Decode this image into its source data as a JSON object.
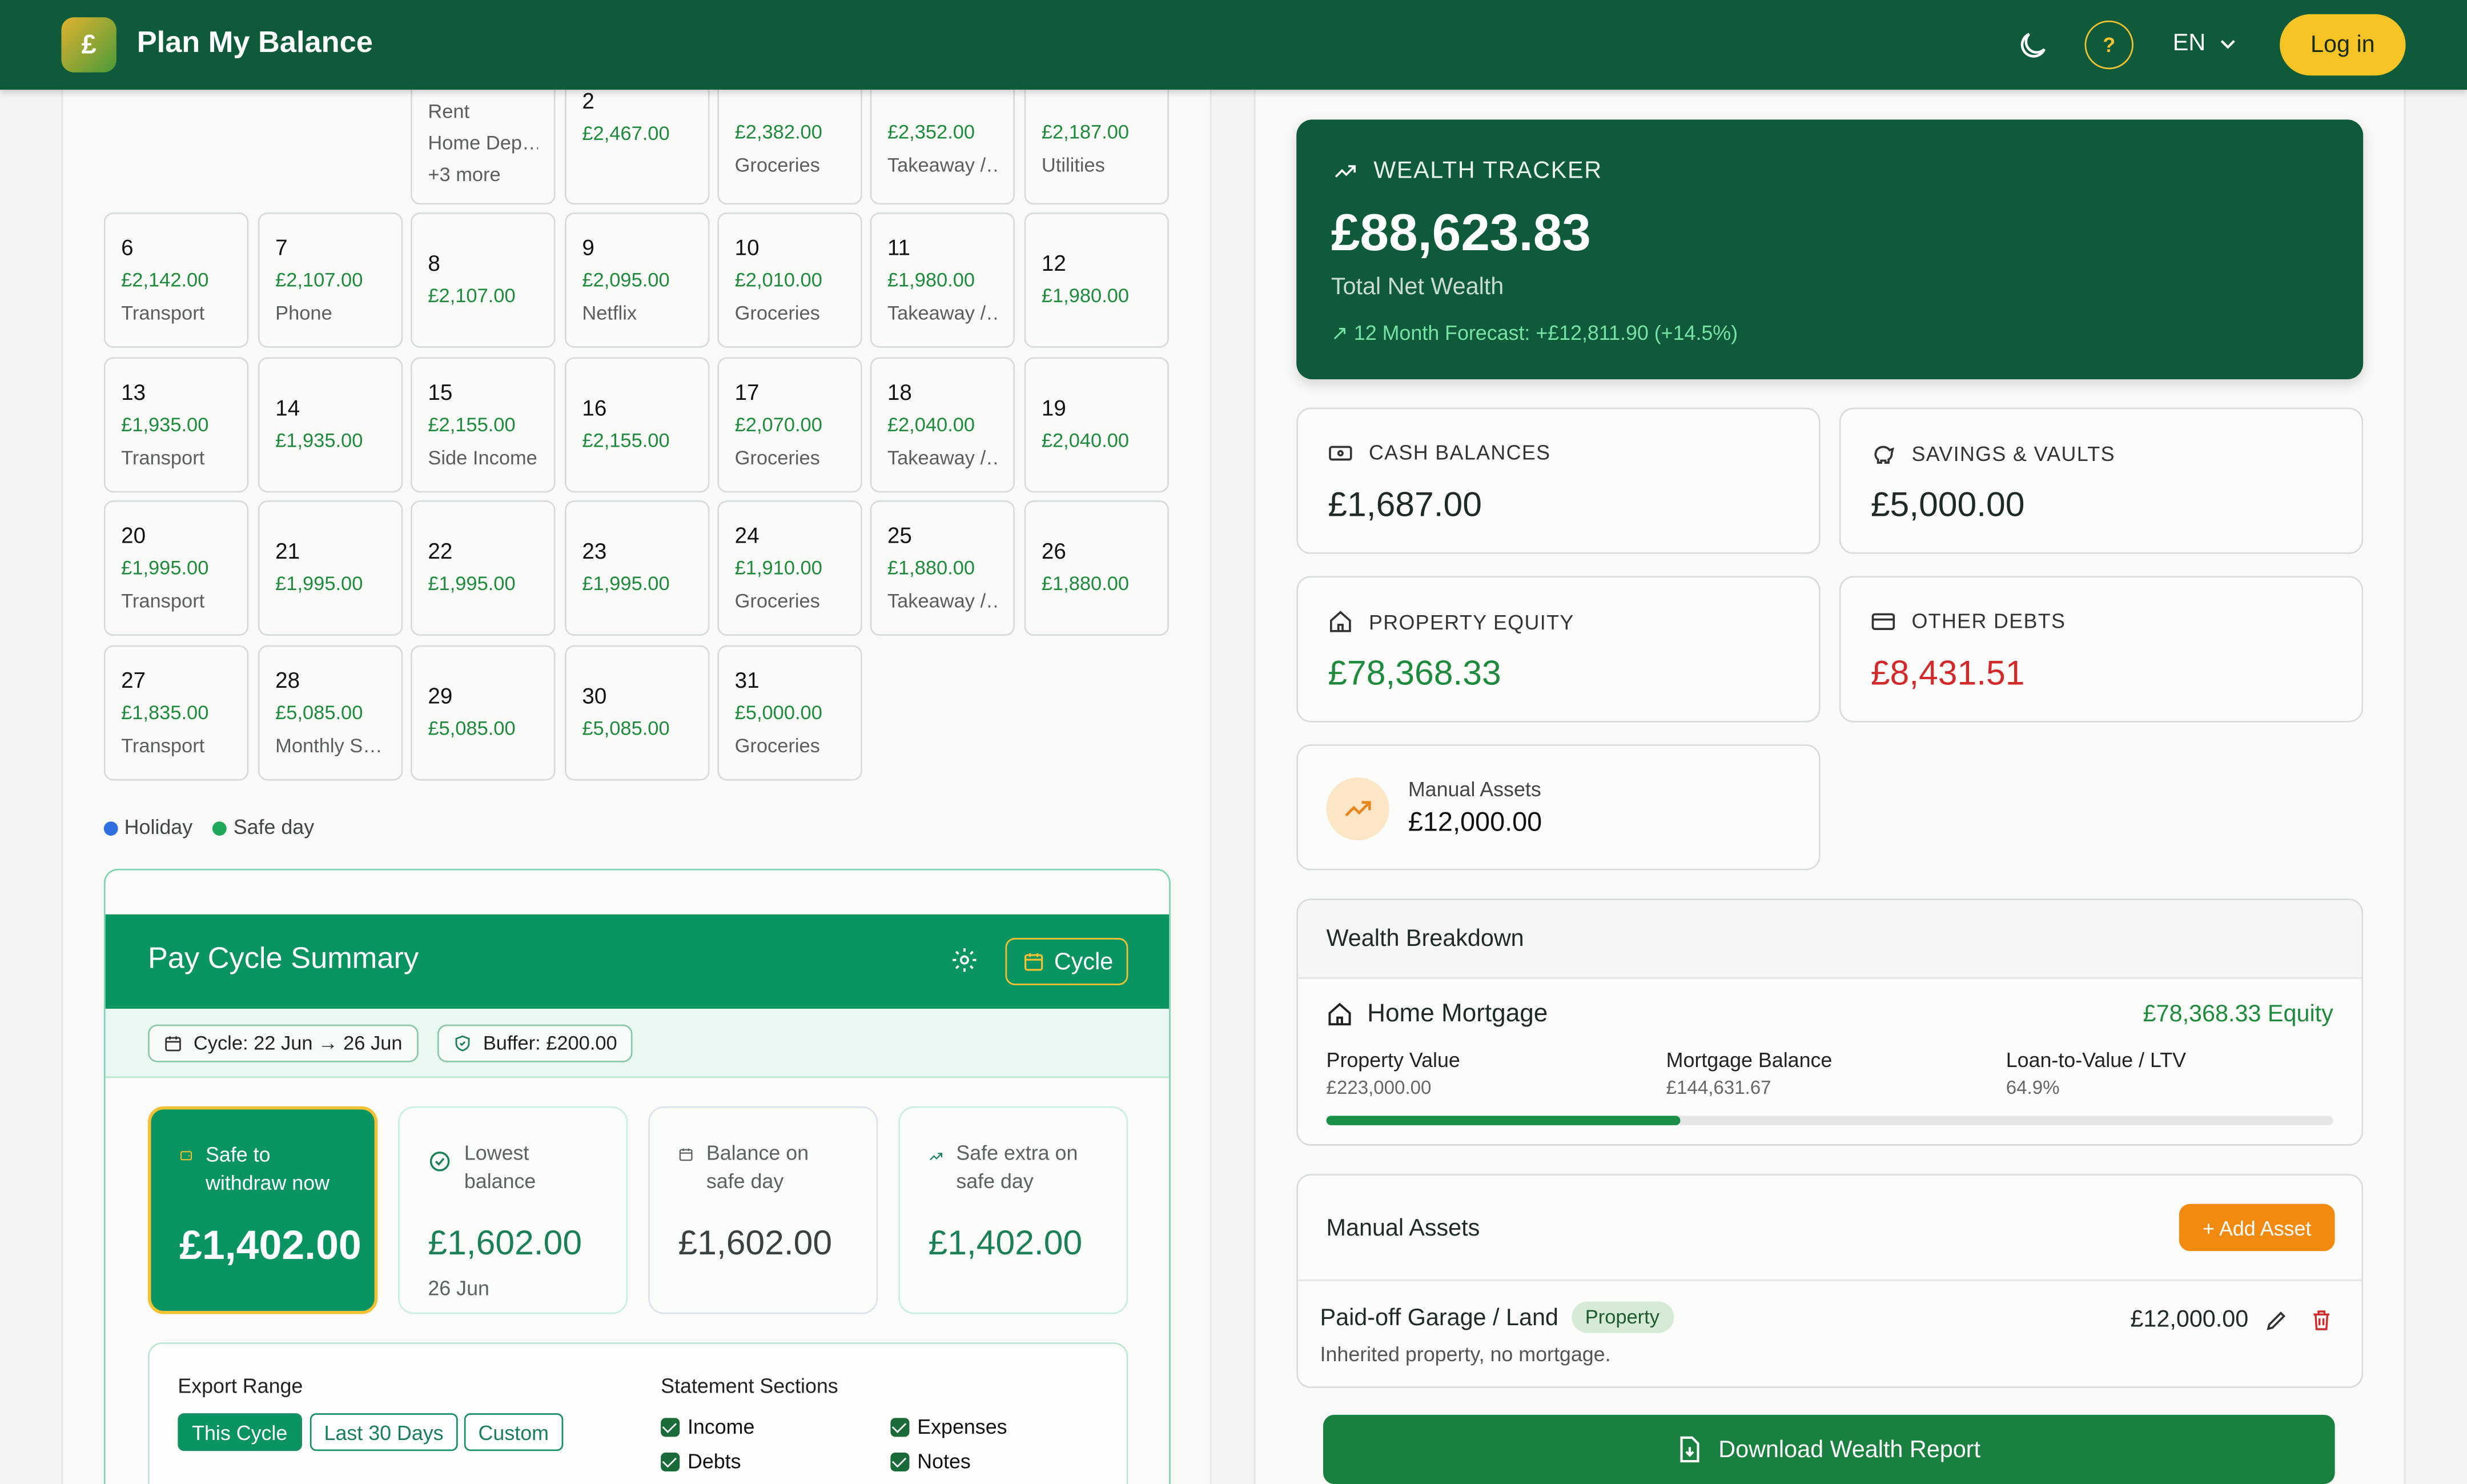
{
  "header": {
    "brand": "Plan My Balance",
    "logo": "£",
    "help": "?",
    "lang": "EN",
    "login": "Log in"
  },
  "calendar": {
    "top_partial": [
      {
        "date": "",
        "amount": "",
        "label": "Rent",
        "label2": "Home Dep…",
        "more": "+3 more"
      },
      {
        "date": "2",
        "amount": "£2,467.00",
        "label": ""
      },
      {
        "date": "",
        "amount": "£2,382.00",
        "label": "Groceries"
      },
      {
        "date": "",
        "amount": "£2,352.00",
        "label": "Takeaway /…"
      },
      {
        "date": "",
        "amount": "£2,187.00",
        "label": "Utilities"
      }
    ],
    "weeks": [
      [
        {
          "date": "6",
          "amount": "£2,142.00",
          "label": "Transport"
        },
        {
          "date": "7",
          "amount": "£2,107.00",
          "label": "Phone"
        },
        {
          "date": "8",
          "amount": "£2,107.00",
          "label": ""
        },
        {
          "date": "9",
          "amount": "£2,095.00",
          "label": "Netflix"
        },
        {
          "date": "10",
          "amount": "£2,010.00",
          "label": "Groceries"
        },
        {
          "date": "11",
          "amount": "£1,980.00",
          "label": "Takeaway /…"
        },
        {
          "date": "12",
          "amount": "£1,980.00",
          "label": ""
        }
      ],
      [
        {
          "date": "13",
          "amount": "£1,935.00",
          "label": "Transport"
        },
        {
          "date": "14",
          "amount": "£1,935.00",
          "label": ""
        },
        {
          "date": "15",
          "amount": "£2,155.00",
          "label": "Side Income"
        },
        {
          "date": "16",
          "amount": "£2,155.00",
          "label": ""
        },
        {
          "date": "17",
          "amount": "£2,070.00",
          "label": "Groceries"
        },
        {
          "date": "18",
          "amount": "£2,040.00",
          "label": "Takeaway /…"
        },
        {
          "date": "19",
          "amount": "£2,040.00",
          "label": ""
        }
      ],
      [
        {
          "date": "20",
          "amount": "£1,995.00",
          "label": "Transport"
        },
        {
          "date": "21",
          "amount": "£1,995.00",
          "label": ""
        },
        {
          "date": "22",
          "amount": "£1,995.00",
          "label": ""
        },
        {
          "date": "23",
          "amount": "£1,995.00",
          "label": ""
        },
        {
          "date": "24",
          "amount": "£1,910.00",
          "label": "Groceries"
        },
        {
          "date": "25",
          "amount": "£1,880.00",
          "label": "Takeaway /…"
        },
        {
          "date": "26",
          "amount": "£1,880.00",
          "label": ""
        }
      ],
      [
        {
          "date": "27",
          "amount": "£1,835.00",
          "label": "Transport"
        },
        {
          "date": "28",
          "amount": "£5,085.00",
          "label": "Monthly S…"
        },
        {
          "date": "29",
          "amount": "£5,085.00",
          "label": ""
        },
        {
          "date": "30",
          "amount": "£5,085.00",
          "label": ""
        },
        {
          "date": "31",
          "amount": "£5,000.00",
          "label": "Groceries"
        }
      ]
    ],
    "legend": {
      "holiday": "Holiday",
      "safe": "Safe day",
      "holiday_color": "#2f6fe0",
      "safe_color": "#1fa85a"
    }
  },
  "pay_cycle": {
    "title": "Pay Cycle Summary",
    "cycle_btn": "Cycle",
    "chip_cycle": "Cycle: 22 Jun → 26 Jun",
    "chip_buffer": "Buffer: £200.00",
    "stats": {
      "safe": {
        "caption": "Safe to withdraw now",
        "value": "£1,402.00"
      },
      "lowest": {
        "caption": "Lowest balance",
        "value": "£1,602.00",
        "sub": "26 Jun"
      },
      "balance": {
        "caption": "Balance on safe day",
        "value": "£1,602.00"
      },
      "extra": {
        "caption": "Safe extra on safe day",
        "value": "£1,402.00"
      }
    },
    "export": {
      "range_label": "Export Range",
      "ranges": [
        "This Cycle",
        "Last 30 Days",
        "Custom"
      ],
      "sections_label": "Statement Sections",
      "sections": [
        "Income",
        "Expenses",
        "Debts",
        "Notes"
      ]
    }
  },
  "wealth": {
    "header": "WEALTH TRACKER",
    "total": "£88,623.83",
    "total_label": "Total Net Wealth",
    "forecast": "↗ 12 Month Forecast: +£12,811.90 (+14.5%)",
    "tiles": {
      "cash": {
        "label": "CASH BALANCES",
        "value": "£1,687.00"
      },
      "savings": {
        "label": "SAVINGS & VAULTS",
        "value": "£5,000.00"
      },
      "property": {
        "label": "PROPERTY EQUITY",
        "value": "£78,368.33"
      },
      "debts": {
        "label": "OTHER DEBTS",
        "value": "£8,431.51"
      }
    },
    "manual_tile": {
      "label": "Manual Assets",
      "value": "£12,000.00"
    },
    "breakdown": {
      "title": "Wealth Breakdown",
      "item": "Home Mortgage",
      "equity": "£78,368.33 Equity",
      "property_value_label": "Property Value",
      "property_value": "£223,000.00",
      "mortgage_label": "Mortgage Balance",
      "mortgage": "£144,631.67",
      "ltv_label": "Loan-to-Value / LTV",
      "ltv": "64.9%",
      "equity_fraction": 0.351
    },
    "manual_assets": {
      "title": "Manual Assets",
      "add": "+ Add Asset",
      "asset_name": "Paid-off Garage / Land",
      "asset_tag": "Property",
      "asset_value": "£12,000.00",
      "asset_note": "Inherited property, no mortgage."
    },
    "download": "Download Wealth Report"
  }
}
